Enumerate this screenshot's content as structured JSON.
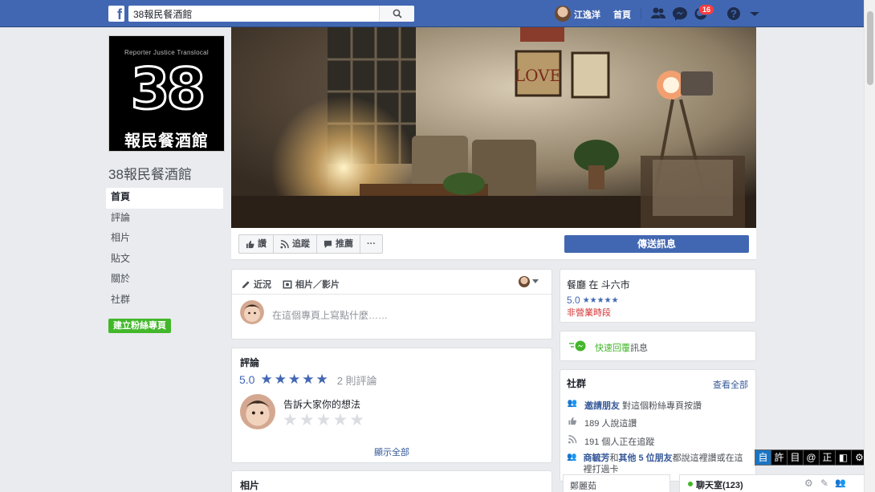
{
  "topbar": {
    "logo": "f",
    "search_value": "38報民餐酒館",
    "user_name": "江逸洋",
    "home": "首頁",
    "notification_count": "16"
  },
  "page": {
    "profile": {
      "tagline": "Reporter  Justice  Translocal",
      "number": "38",
      "name_cn": "報民餐酒館"
    },
    "title": "38報民餐酒館",
    "nav": [
      "首頁",
      "評論",
      "相片",
      "貼文",
      "關於",
      "社群"
    ],
    "create_page": "建立粉絲專頁"
  },
  "actions": {
    "like": "讚",
    "follow": "追蹤",
    "share": "推薦",
    "more": "···",
    "send_message": "傳送訊息"
  },
  "composer": {
    "tab_status": "近況",
    "tab_photo": "相片／影片",
    "placeholder": "在這個專頁上寫點什麼……"
  },
  "reviews": {
    "heading": "評論",
    "score": "5.0",
    "count": "2 則評論",
    "prompt": "告訴大家你的想法",
    "show_all": "顯示全部"
  },
  "photos": {
    "heading": "相片"
  },
  "about": {
    "category": "餐廳 在 斗六市",
    "rating": "5.0",
    "status": "非營業時段"
  },
  "quick_reply": {
    "highlight": "快速回覆",
    "rest": "訊息"
  },
  "community": {
    "heading": "社群",
    "see_all": "查看全部",
    "invite_link": "邀請朋友",
    "invite_rest": " 對這個粉絲專頁按讚",
    "likes": "189 人說這讚",
    "follows": "191 個人正在追蹤",
    "friend_name": "商毓芳",
    "friend_mid": "和",
    "friend_others": "其他 5 位朋友",
    "friend_rest": "都說這裡讚或在這裡打過卡"
  },
  "bottom": {
    "mini_tab": "鄭麗茹",
    "chat": "聊天室(123)",
    "ime_keys": [
      "自",
      "許",
      "目",
      "@",
      "正",
      "◧",
      "⚙"
    ]
  },
  "colors": {
    "brand": "#4267b2",
    "badge": "#fa3e3e",
    "create_btn": "#42b72a",
    "status_closed": "#d32f2f"
  }
}
